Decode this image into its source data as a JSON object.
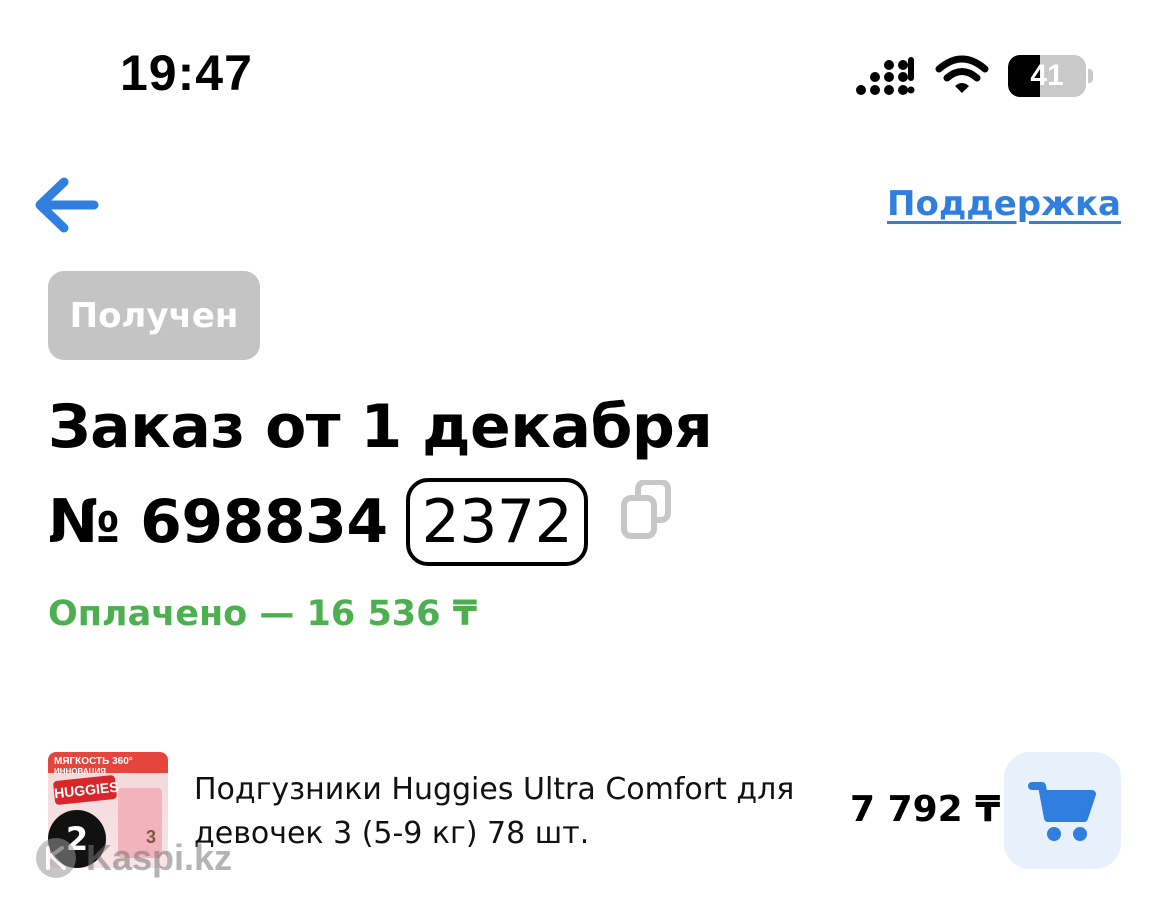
{
  "status_bar": {
    "time": "19:47",
    "battery": "41",
    "battery_level": 0.41,
    "icons": [
      "signal-icon",
      "wifi-icon",
      "battery-icon"
    ]
  },
  "header": {
    "back_icon": "back-arrow-icon",
    "support_label": "Поддержка"
  },
  "order": {
    "status_badge": "Получен",
    "title": "Заказ от 1 декабря",
    "number_prefix": "№ 698834",
    "number_suffix": "2372",
    "copy_icon": "copy-icon",
    "payment": "Оплачено — 16 536 ₸"
  },
  "items": [
    {
      "name": "Подгузники Huggies Ultra Comfort для девочек 3 (5-9 кг) 78 шт.",
      "price": "7 792 ₸",
      "quantity": "2",
      "image_texts": {
        "band_top": "МЯГКОСТЬ 360°",
        "band_sub": "ИННОВАЦИЯ",
        "brand": "HUGGIES",
        "size": "3"
      },
      "cart_icon": "cart-icon"
    }
  ],
  "watermark": "Kaspi.kz",
  "colors": {
    "accent_blue": "#2f7ee0",
    "paid_green": "#4caf50",
    "badge_gray": "#c4c4c4",
    "cart_bg": "#e7f0fb"
  }
}
